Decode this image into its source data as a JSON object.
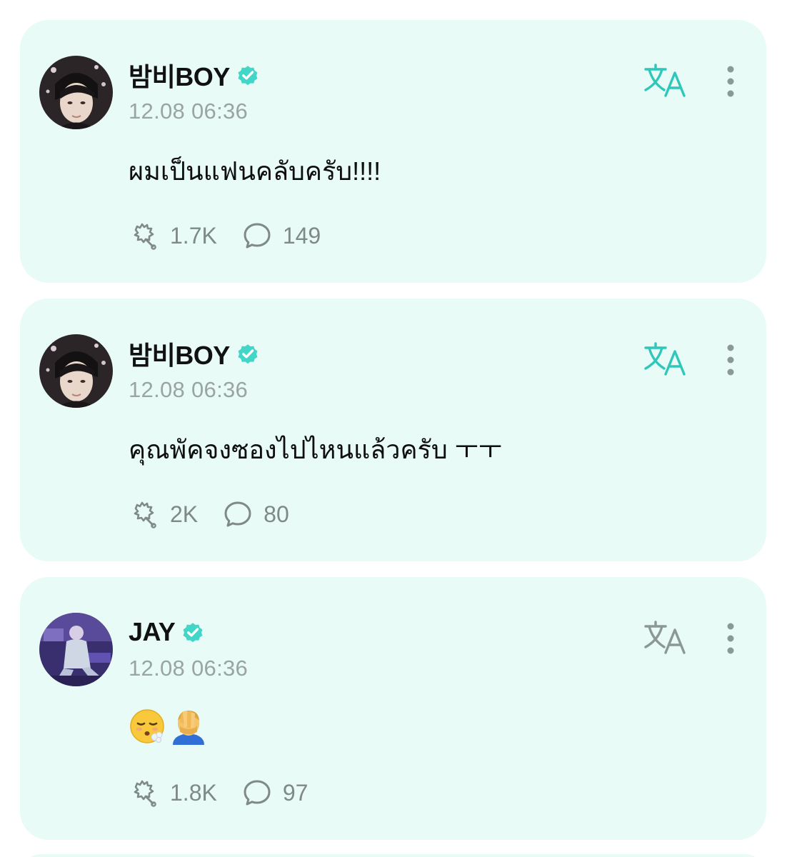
{
  "posts": [
    {
      "author": "밤비BOY",
      "verified": true,
      "timestamp": "12.08 06:36",
      "text": "ผมเป็นแฟนคลับครับ!!!!",
      "likes": "1.7K",
      "comments": "149",
      "translate_active": true
    },
    {
      "author": "밤비BOY",
      "verified": true,
      "timestamp": "12.08 06:36",
      "text": "คุณพัคจงซองไปไหนแล้วครับ ㅜㅜ",
      "likes": "2K",
      "comments": "80",
      "translate_active": true
    },
    {
      "author": "JAY",
      "verified": true,
      "timestamp": "12.08 06:36",
      "emojis": [
        "face-exhaling-emoji",
        "man-facepalming-emoji"
      ],
      "likes": "1.8K",
      "comments": "97",
      "translate_active": false
    }
  ],
  "icons": {
    "like": "like-icon",
    "comment": "comment-icon",
    "translate": "translate-icon",
    "more": "more-vertical-icon",
    "verified": "verified-badge-icon"
  },
  "colors": {
    "card_background": "#e8fbf6",
    "accent": "#2ec7b9",
    "translate_inactive": "#8c9896",
    "verified": "#41d6c7",
    "meta_text": "#9aa5a3"
  }
}
